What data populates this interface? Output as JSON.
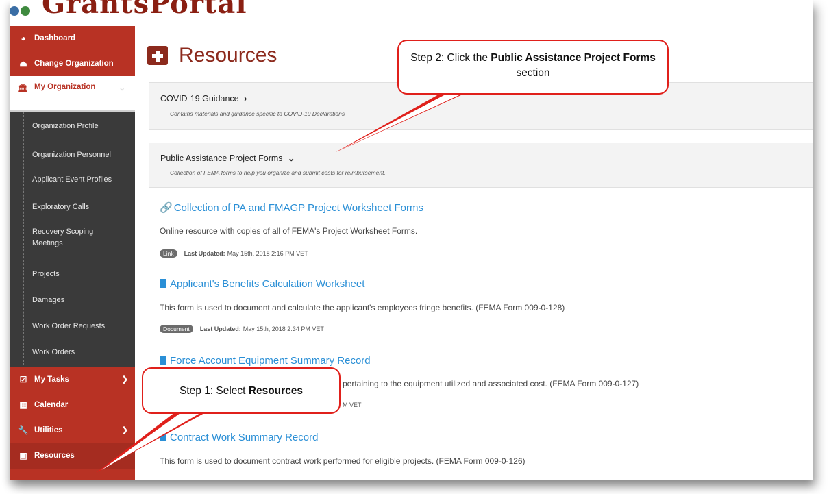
{
  "app": {
    "logo_text": "GrantsPortal"
  },
  "sidebar": {
    "top_items": [
      {
        "label": "Dashboard",
        "icon": "dashboard-icon"
      },
      {
        "label": "Change Organization",
        "icon": "eject-icon"
      }
    ],
    "my_organization": {
      "label": "My Organization",
      "icon": "bank-icon"
    },
    "sub_items": [
      "Organization Profile",
      "Organization Personnel",
      "Applicant Event Profiles",
      "Exploratory Calls",
      "Recovery Scoping Meetings",
      "Projects",
      "Damages",
      "Work Order Requests",
      "Work Orders"
    ],
    "bottom_items": [
      {
        "label": "My Tasks",
        "icon": "checkbox-icon",
        "has_chevron": true
      },
      {
        "label": "Calendar",
        "icon": "calendar-icon",
        "has_chevron": false
      },
      {
        "label": "Utilities",
        "icon": "wrench-icon",
        "has_chevron": true
      },
      {
        "label": "Resources",
        "icon": "medkit-icon",
        "has_chevron": false
      }
    ]
  },
  "main": {
    "page_title": "Resources",
    "sections": [
      {
        "title": "COVID-19 Guidance",
        "chevron": "›",
        "description": "Contains materials and guidance specific to COVID-19 Declarations"
      },
      {
        "title": "Public Assistance Project Forms",
        "chevron": "⌄",
        "description": "Collection of FEMA forms to help you organize and submit costs for reimbursement."
      }
    ],
    "resources": [
      {
        "icon": "link-icon",
        "title": "Collection of PA and FMAGP Project Worksheet Forms",
        "description": "Online resource with copies of all of FEMA's Project Worksheet Forms.",
        "badge": "Link",
        "updated_label": "Last Updated:",
        "updated_value": "May 15th, 2018 2:16 PM VET"
      },
      {
        "icon": "document-icon",
        "title": "Applicant's Benefits Calculation Worksheet",
        "description": "This form is used to document and calculate the applicant's employees fringe benefits. (FEMA Form 009-0-128)",
        "badge": "Document",
        "updated_label": "Last Updated:",
        "updated_value": "May 15th, 2018 2:34 PM VET"
      },
      {
        "icon": "document-icon",
        "title": "Force Account Equipment Summary Record",
        "description": "pertaining to the equipment utilized and associated cost. (FEMA Form 009-0-127)",
        "badge": "",
        "updated_label": "",
        "updated_value": "M VET"
      },
      {
        "icon": "document-icon",
        "title": "Contract Work Summary Record",
        "description": "This form is used to document contract work performed for eligible projects. (FEMA Form 009-0-126)",
        "badge": "",
        "updated_label": "",
        "updated_value": ""
      }
    ]
  },
  "callouts": {
    "step1_prefix": "Step 1: Select ",
    "step1_bold": "Resources",
    "step2_prefix": "Step 2: Click the ",
    "step2_bold": "Public Assistance Project Forms",
    "step2_suffix": " section"
  },
  "colors": {
    "brand_red": "#b83224",
    "sidebar_dark": "#3a3a3a",
    "link_blue": "#2a8fd6",
    "callout_red": "#e0201b"
  }
}
